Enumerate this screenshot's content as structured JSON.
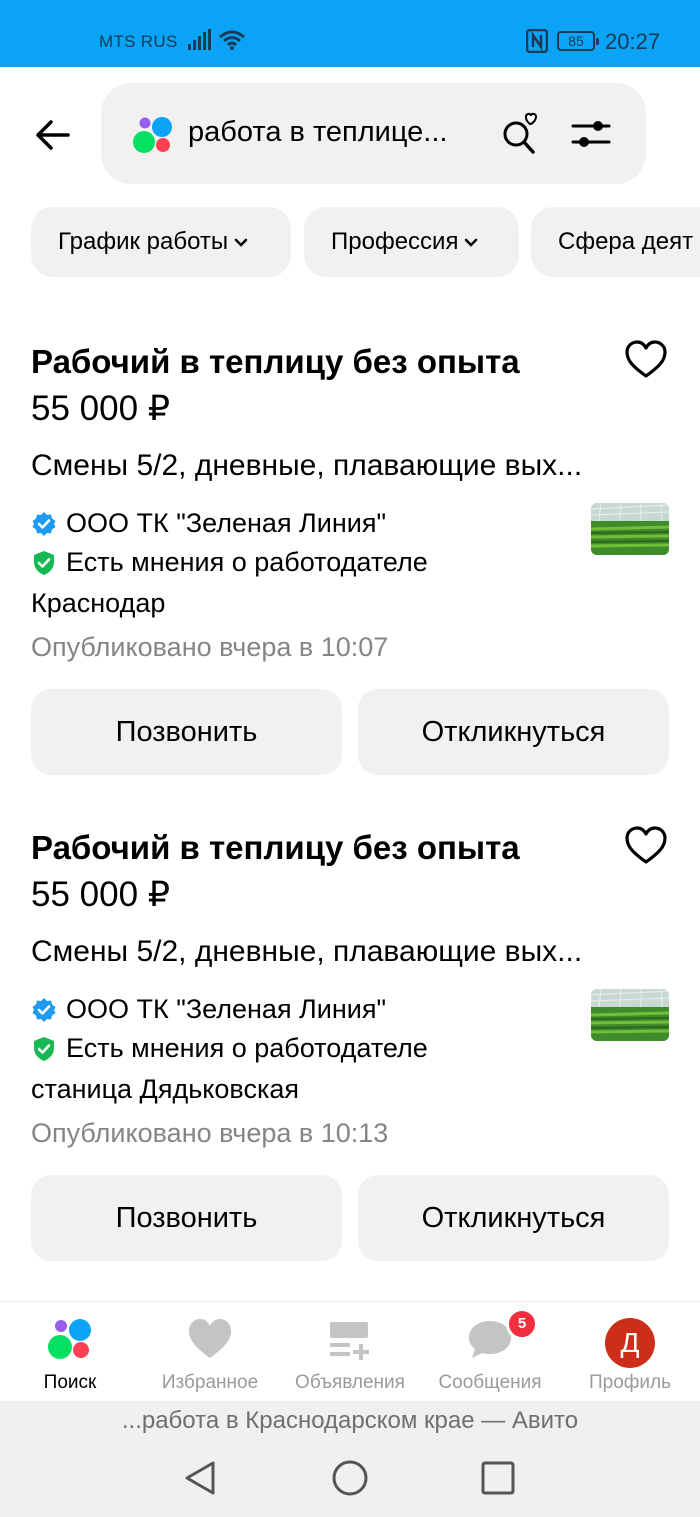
{
  "status_bar": {
    "carrier": "MTS RUS",
    "battery": "85",
    "time": "20:27"
  },
  "search": {
    "query": "работа в теплице..."
  },
  "filters": [
    {
      "label": "График работы"
    },
    {
      "label": "Профессия"
    },
    {
      "label": "Сфера деят"
    }
  ],
  "listings": [
    {
      "title": "Рабочий в теплицу без опыта",
      "price": "55 000 ₽",
      "description": "Смены 5/2, дневные, плавающие вых...",
      "company": "ООО ТК \"Зеленая Линия\"",
      "reviews": "Есть мнения о работодателе",
      "location": "Краснодар",
      "published": "Опубликовано вчера в 10:07",
      "call_label": "Позвонить",
      "respond_label": "Откликнуться"
    },
    {
      "title": "Рабочий в теплицу без опыта",
      "price": "55 000 ₽",
      "description": "Смены 5/2, дневные, плавающие вых...",
      "company": "ООО ТК \"Зеленая Линия\"",
      "reviews": "Есть мнения о работодателе",
      "location": "станица Дядьковская",
      "published": "Опубликовано вчера в 10:13",
      "call_label": "Позвонить",
      "respond_label": "Откликнуться"
    }
  ],
  "bottom_nav": {
    "search": "Поиск",
    "favorites": "Избранное",
    "ads": "Объявления",
    "messages": "Сообщения",
    "messages_badge": "5",
    "profile": "Профиль",
    "profile_initial": "Д"
  },
  "browser": {
    "page_title": "...работа в Краснодарском крае — Авито"
  },
  "colors": {
    "status_bar": "#0aa3f5",
    "chip_bg": "#f2f1f0",
    "verified": "#1e9af0",
    "reviews_shield": "#16b854",
    "badge": "#f0303e",
    "avatar": "#cc2e1a"
  }
}
